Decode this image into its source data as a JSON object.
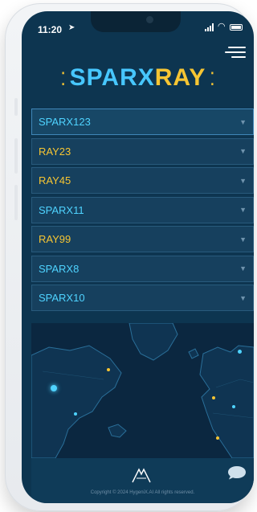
{
  "status": {
    "time": "11:20"
  },
  "logo": {
    "part1": "SPARX",
    "part2": "RAY"
  },
  "devices": [
    {
      "name": "SPARX123",
      "color": "#4fd3ff"
    },
    {
      "name": "RAY23",
      "color": "#f6c533"
    },
    {
      "name": "RAY45",
      "color": "#f6c533"
    },
    {
      "name": "SPARX11",
      "color": "#4fd3ff"
    },
    {
      "name": "RAY99",
      "color": "#f6c533"
    },
    {
      "name": "SPARX8",
      "color": "#4fd3ff"
    },
    {
      "name": "SPARX10",
      "color": "#4fd3ff"
    }
  ],
  "footer": {
    "copyright": "Copyright © 2024 HygeniX.AI All rights reserved."
  },
  "colors": {
    "accent_cyan": "#4fd3ff",
    "accent_yellow": "#f6c533",
    "background": "#0d3550"
  }
}
